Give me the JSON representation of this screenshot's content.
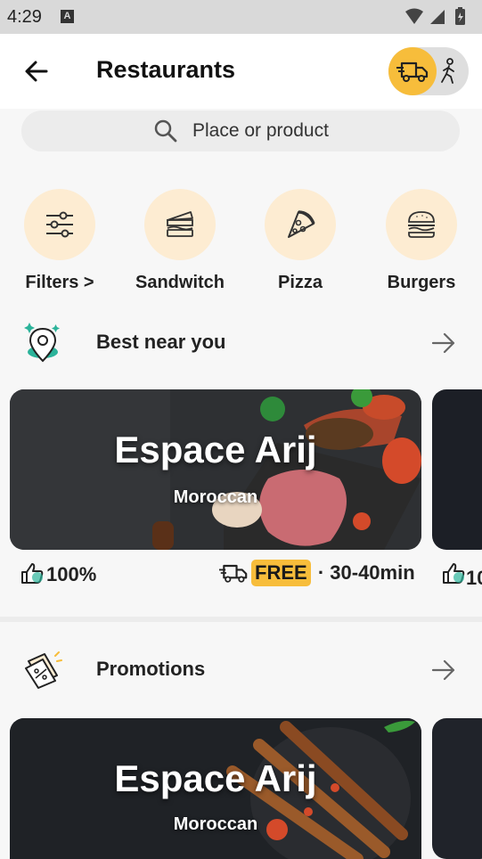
{
  "status_bar": {
    "time": "4:29",
    "notification_icon": "A"
  },
  "header": {
    "title": "Restaurants"
  },
  "search": {
    "placeholder": "Place or product"
  },
  "categories": [
    {
      "label": "Filters >",
      "icon": "sliders-icon"
    },
    {
      "label": "Sandwitch",
      "icon": "sandwich-icon"
    },
    {
      "label": "Pizza",
      "icon": "pizza-icon"
    },
    {
      "label": "Burgers",
      "icon": "burger-icon"
    }
  ],
  "best_near_you": {
    "title": "Best near you",
    "card": {
      "name": "Espace Arij",
      "cuisine": "Moroccan"
    },
    "meta": {
      "rating": "100%",
      "delivery_fee": "FREE",
      "separator": "·",
      "delivery_time": "30-40min"
    },
    "peek_rating": "10"
  },
  "promotions": {
    "title": "Promotions",
    "card": {
      "name": "Espace Arij",
      "cuisine": "Moroccan"
    }
  },
  "colors": {
    "accent": "#f7bd3b",
    "category_bg": "#fdecd2",
    "teal": "#2bb39a"
  }
}
